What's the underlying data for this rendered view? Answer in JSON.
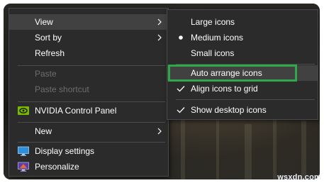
{
  "context_menu": {
    "items": [
      {
        "label": "View",
        "disabled": false
      },
      {
        "label": "Sort by",
        "disabled": false
      },
      {
        "label": "Refresh",
        "disabled": false
      },
      {
        "label": "Paste",
        "disabled": true
      },
      {
        "label": "Paste shortcut",
        "disabled": true
      },
      {
        "label": "NVIDIA Control Panel",
        "disabled": false
      },
      {
        "label": "New",
        "disabled": false
      },
      {
        "label": "Display settings",
        "disabled": false
      },
      {
        "label": "Personalize",
        "disabled": false
      }
    ]
  },
  "view_submenu": {
    "items": [
      {
        "label": "Large icons",
        "mark": "none"
      },
      {
        "label": "Medium icons",
        "mark": "bullet"
      },
      {
        "label": "Small icons",
        "mark": "none"
      },
      {
        "label": "Auto arrange icons",
        "mark": "none",
        "highlighted": true
      },
      {
        "label": "Align icons to grid",
        "mark": "check"
      },
      {
        "label": "Show desktop icons",
        "mark": "check"
      }
    ]
  },
  "watermark": "wsxdn.com",
  "colors": {
    "menu_bg": "#2b2b2b",
    "highlight_box": "#2ea84a",
    "nvidia_green": "#76b900",
    "display_icon": "#2f8fdb"
  },
  "icons": {
    "nvidia": "nvidia-icon",
    "display": "display-settings-icon",
    "personalize": "personalize-icon",
    "submenu": "chevron-right-icon",
    "check": "check-icon",
    "bullet": "bullet-icon"
  }
}
